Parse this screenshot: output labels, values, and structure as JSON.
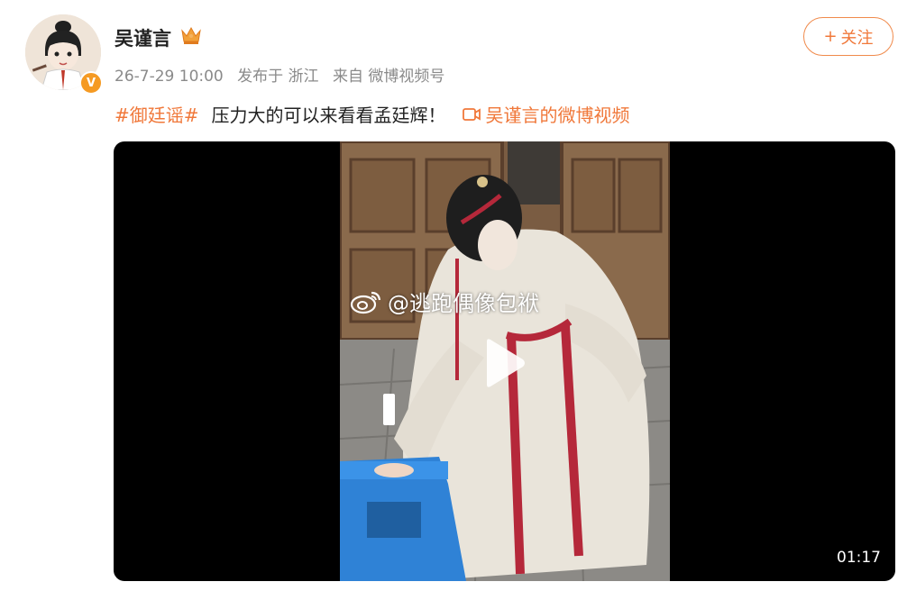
{
  "user": {
    "name": "吴谨言",
    "verified_badge": "V"
  },
  "meta": {
    "time": "26-7-29 10:00",
    "location": "发布于 浙江",
    "source": "来自 微博视频号"
  },
  "follow_button": {
    "icon": "+",
    "label": "关注"
  },
  "post": {
    "hashtag": "#御廷谣#",
    "text": "压力大的可以来看看孟廷辉！",
    "video_link": "吴谨言的微博视频"
  },
  "video": {
    "watermark": "@逃跑偶像包袱",
    "duration": "01:17"
  },
  "colors": {
    "accent": "#f0783a",
    "verified": "#f59a23"
  }
}
